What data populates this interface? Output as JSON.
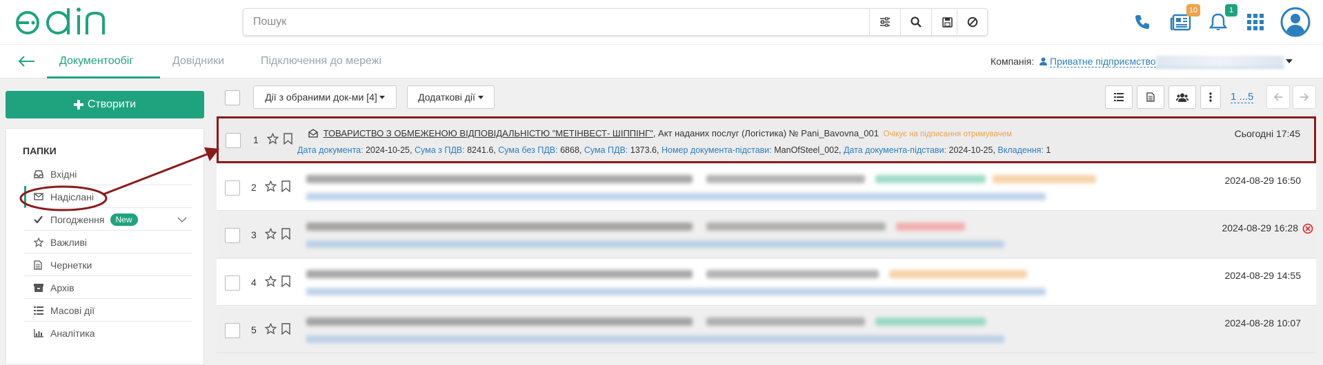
{
  "header": {
    "logo": "edin",
    "search_placeholder": "Пошук",
    "documents_badge": "10",
    "notifications_badge": "1"
  },
  "nav": {
    "tabs": [
      "Документообіг",
      "Довідники",
      "Підключення до мережі"
    ],
    "company_label": "Компанія:",
    "company_value": "Приватне підприємство"
  },
  "sidebar": {
    "create_label": "Створити",
    "folders_title": "ПАПКИ",
    "items": [
      {
        "label": "Вхідні",
        "icon": "inbox-icon"
      },
      {
        "label": "Надіслані",
        "icon": "envelope-icon"
      },
      {
        "label": "Погодження",
        "icon": "check-icon",
        "badge": "New"
      },
      {
        "label": "Важливі",
        "icon": "star-icon"
      },
      {
        "label": "Чернетки",
        "icon": "draft-icon"
      },
      {
        "label": "Архів",
        "icon": "archive-icon"
      },
      {
        "label": "Масові дії",
        "icon": "bulk-icon"
      },
      {
        "label": "Аналітика",
        "icon": "chart-icon"
      }
    ]
  },
  "toolbar": {
    "bulk_actions": "Дії з обраними док-ми [4]",
    "extra_actions": "Додаткові дії",
    "pager": "1 ...5"
  },
  "documents": [
    {
      "num": "1",
      "company": "ТОВАРИСТВО З ОБМЕЖЕНОЮ ВІДПОВІДАЛЬНІСТЮ \"МЕТІНВЕСТ- ШІППІНГ\"",
      "doc": ", Акт наданих послуг (Логістика) № Pani_Bavovna_001",
      "status": "Очікує на підписання отримувачем",
      "date_label": "Дата документа:",
      "date_value": "2024-10-25,",
      "sum_vat_label": "Сума з ПДВ:",
      "sum_vat_value": "8241.6,",
      "sum_novat_label": "Сума без ПДВ:",
      "sum_novat_value": "6868,",
      "vat_label": "Сума ПДВ:",
      "vat_value": "1373.6,",
      "basis_label": "Номер документа-підстави:",
      "basis_value": "ManOfSteel_002,",
      "basis_date_label": "Дата документа-підстави:",
      "basis_date_value": "2024-10-25,",
      "attach_label": "Вкладення:",
      "attach_value": "1",
      "time": "Сьогодні 17:45"
    },
    {
      "num": "2",
      "time": "2024-08-29 16:50"
    },
    {
      "num": "3",
      "time": "2024-08-29 16:28"
    },
    {
      "num": "4",
      "time": "2024-08-29 14:55"
    },
    {
      "num": "5",
      "time": "2024-08-28 10:07"
    }
  ],
  "colors": {
    "brand": "#1fa37f",
    "link": "#2a7fc1",
    "status_pending": "#f0a24a",
    "highlight": "#8b1a1a",
    "error": "#e02020"
  }
}
